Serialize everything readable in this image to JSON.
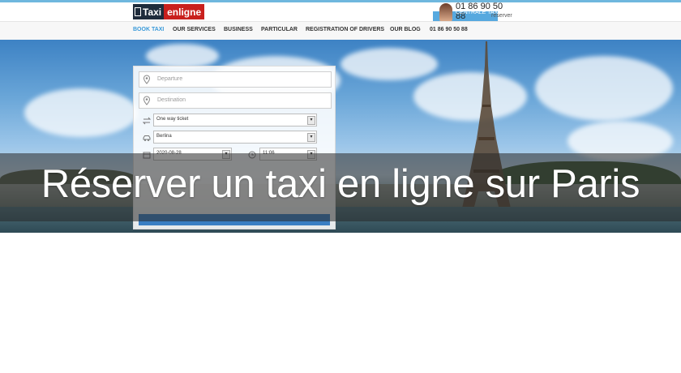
{
  "header": {
    "logo_taxi": "Taxi",
    "logo_enligne": "enligne",
    "phone_number": "01 86 90 50 88",
    "phone_sub": "CENTRALE TAXI",
    "phone_cta": "réserver"
  },
  "nav": {
    "items": [
      {
        "label": "BOOK TAXI",
        "active": true
      },
      {
        "label": "OUR SERVICES"
      },
      {
        "label": "BUSINESS"
      },
      {
        "label": "PARTICULAR"
      },
      {
        "label": "REGISTRATION OF DRIVERS"
      },
      {
        "label": "OUR BLOG"
      },
      {
        "label": "01 86 90 50 88"
      }
    ]
  },
  "booking": {
    "departure_placeholder": "Departure",
    "destination_placeholder": "Destination",
    "trip_type": "One way ticket",
    "vehicle": "Berlina",
    "date": "2020-08-28",
    "time": "11:06"
  },
  "banner": {
    "text": "Réserver un taxi en ligne sur Paris"
  },
  "colors": {
    "accent": "#3a9ad9",
    "brand_red": "#c9201d",
    "brand_dark": "#1f2c3c"
  }
}
